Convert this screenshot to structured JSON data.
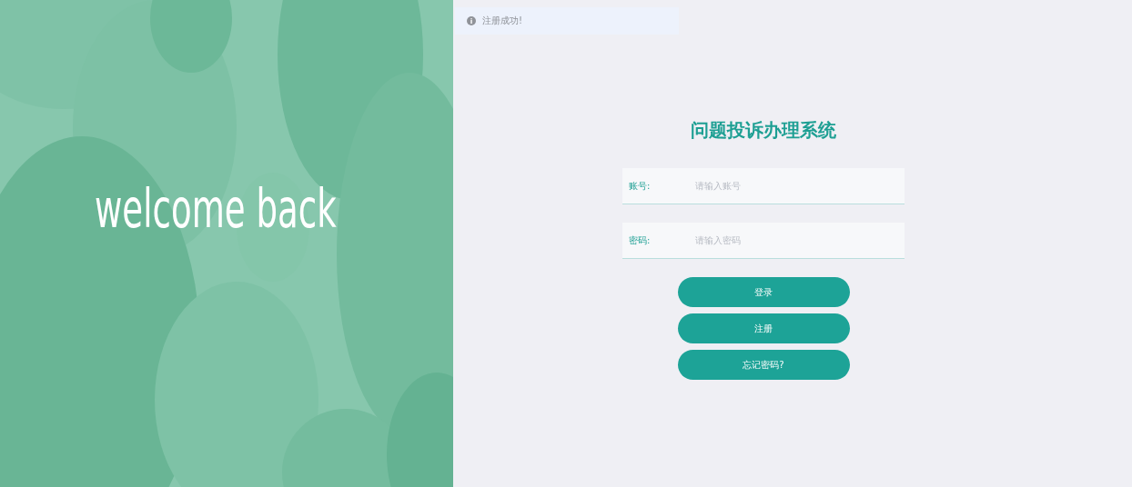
{
  "hero": {
    "kind": "picture",
    "headline": "welcome back"
  },
  "toast": {
    "message": "注册成功!"
  },
  "login": {
    "title": "问题投诉办理系统",
    "fields": [
      {
        "label": "账号:",
        "placeholder": "请输入账号"
      },
      {
        "label": "密码:",
        "placeholder": "请输入密码"
      }
    ],
    "buttons": [
      "登录",
      "注册",
      "忘记密码?"
    ]
  }
}
